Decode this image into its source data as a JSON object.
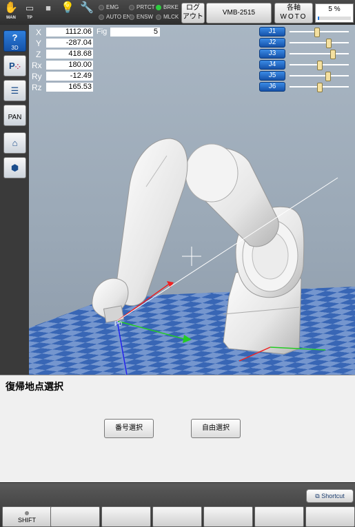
{
  "toolbar": {
    "icons": [
      {
        "name": "hand-icon",
        "caption": "MAN"
      },
      {
        "name": "teach-pendant-icon",
        "caption": "TP"
      },
      {
        "name": "stop-icon",
        "caption": ""
      },
      {
        "name": "lightbulb-icon",
        "caption": ""
      },
      {
        "name": "wrench-icon",
        "caption": ""
      }
    ],
    "status": [
      {
        "label": "EMG",
        "on": false
      },
      {
        "label": "AUTO EN",
        "on": false
      },
      {
        "label": "PRTCT",
        "on": false
      },
      {
        "label": "ENSW",
        "on": false
      },
      {
        "label": "BRKE",
        "on": true
      },
      {
        "label": "MLCK",
        "on": false
      }
    ],
    "logout_line1": "ログ",
    "logout_line2": "アウト",
    "robot_model": "VMB-2515",
    "axis_line1": "各軸",
    "axis_line2": "WOTO",
    "speed_percent": "5 %",
    "speed_value": 5
  },
  "sidebar": {
    "view3d_label": "3D",
    "pan_label": "PAN"
  },
  "coordinates": {
    "labels": {
      "x": "X",
      "y": "Y",
      "z": "Z",
      "rx": "Rx",
      "ry": "Ry",
      "rz": "Rz"
    },
    "values": {
      "x": "1112.06",
      "y": "-287.04",
      "z": "418.68",
      "rx": "180.00",
      "ry": "-12.49",
      "rz": "165.53"
    },
    "fig_label": "Fig",
    "fig_value": "5"
  },
  "joints": [
    {
      "label": "J1",
      "level": 0.45
    },
    {
      "label": "J2",
      "level": 0.65
    },
    {
      "label": "J3",
      "level": 0.72
    },
    {
      "label": "J4",
      "level": 0.5
    },
    {
      "label": "J5",
      "level": 0.64
    },
    {
      "label": "J6",
      "level": 0.5
    }
  ],
  "viewport": {
    "point_label": "P0",
    "colors": {
      "x_axis": "#22cc22",
      "y_axis": "#ee2222",
      "z_axis": "#2222ee",
      "floor_a": "#3d6fbf",
      "floor_b": "#7fa3db"
    }
  },
  "dialog": {
    "title": "復帰地点選択",
    "number_select_label": "番号選択",
    "free_select_label": "自由選択"
  },
  "footer": {
    "shortcut_label": "Shortcut",
    "shift_label": "SHIFT"
  }
}
